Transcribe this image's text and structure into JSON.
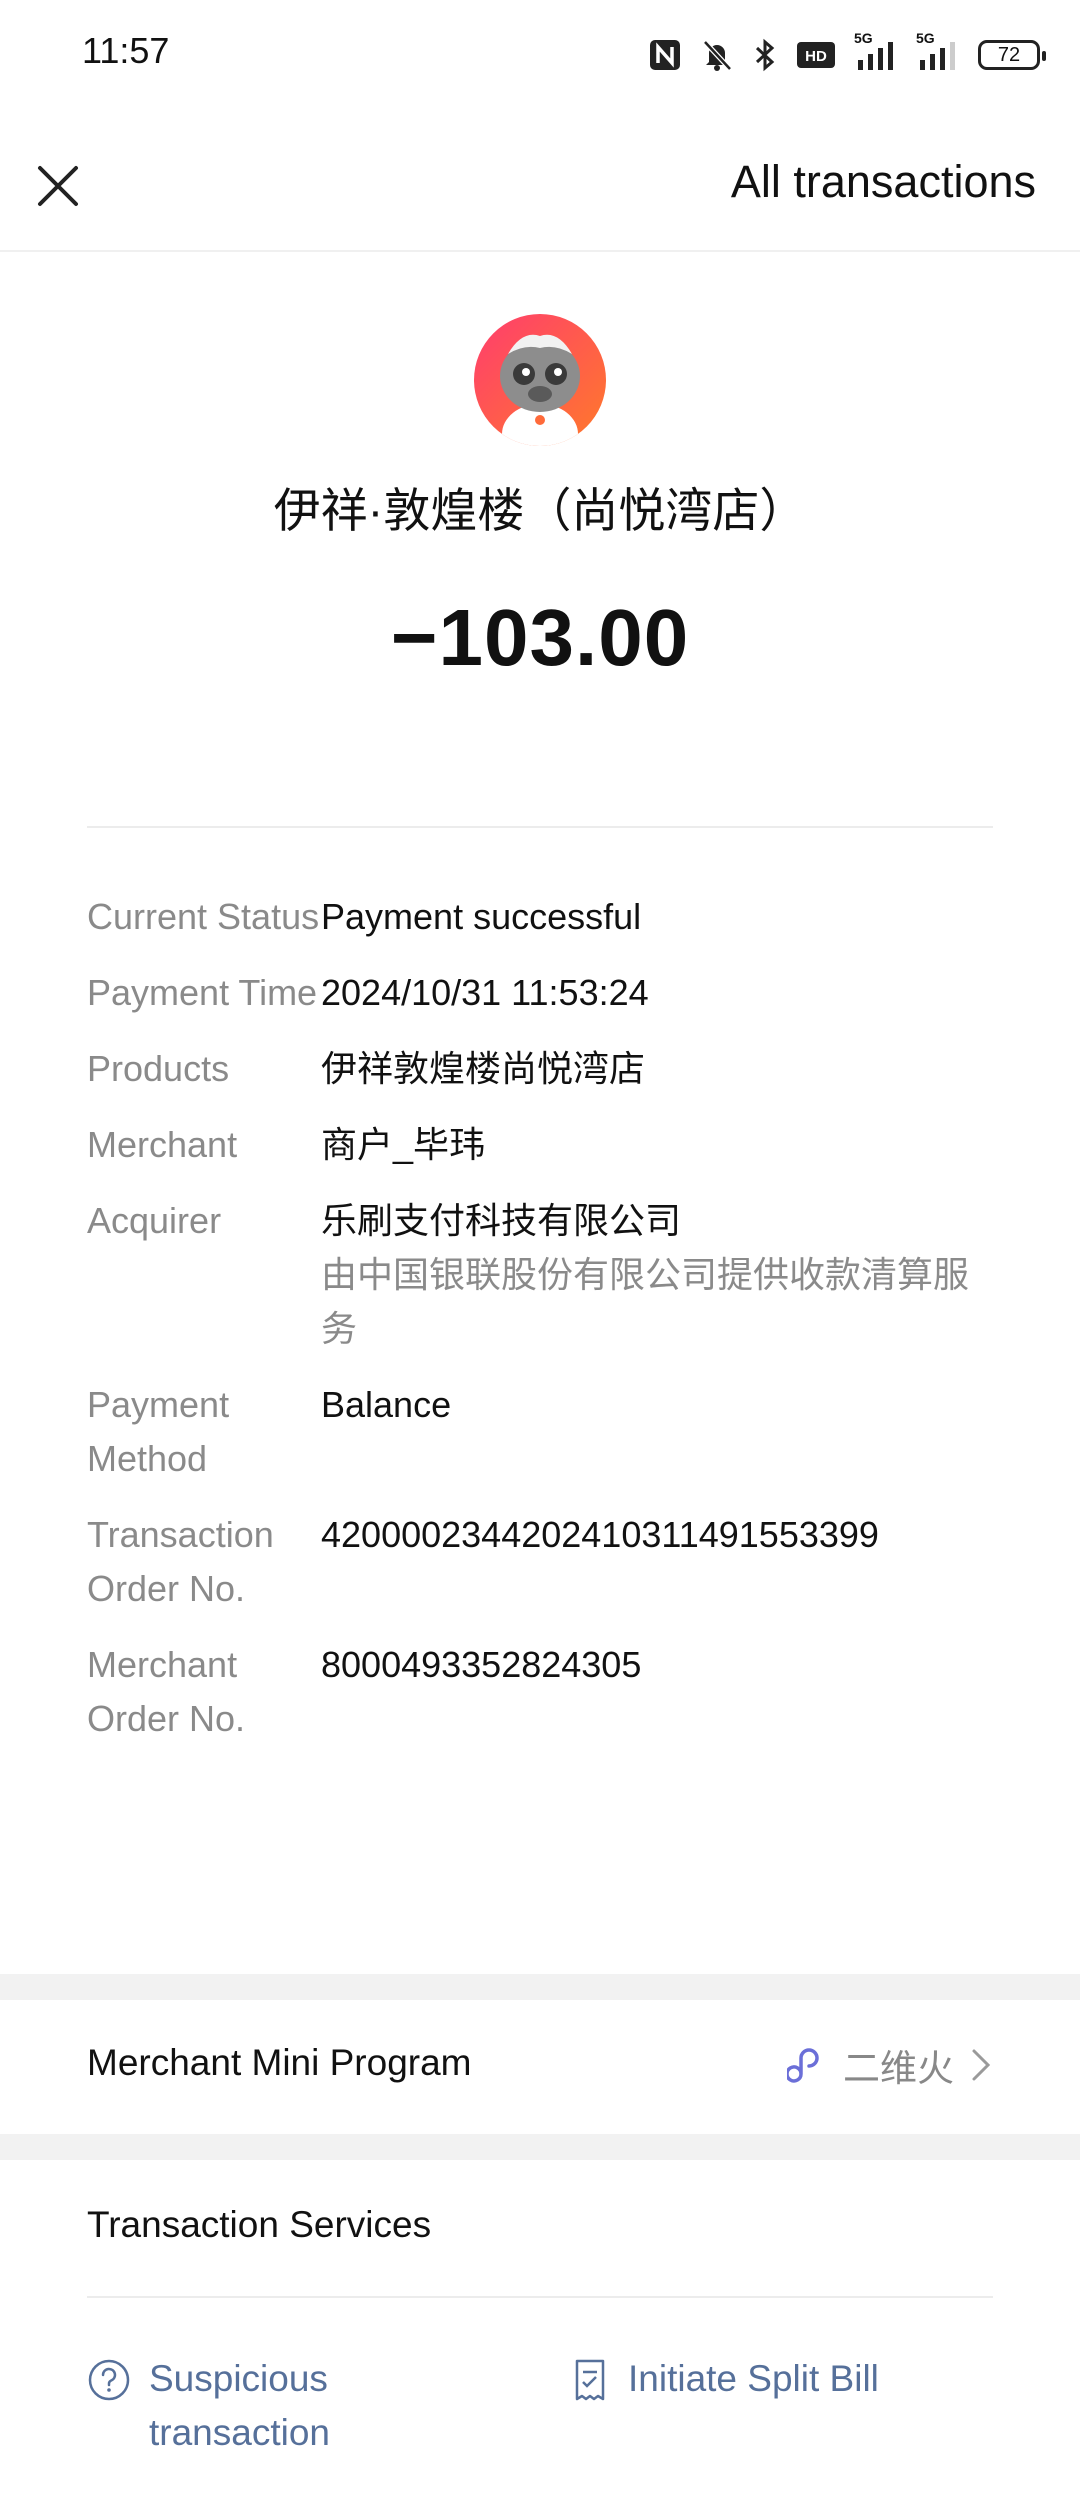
{
  "status_bar": {
    "time": "11:57",
    "battery": "72",
    "signal_1": "5G",
    "signal_2": "5G"
  },
  "header": {
    "close_icon": "close-icon",
    "all_transactions": "All transactions"
  },
  "merchant": {
    "name": "伊祥·敦煌楼（尚悦湾店）",
    "amount": "−103.00"
  },
  "details": [
    {
      "label": "Current Status",
      "value": "Payment successful"
    },
    {
      "label": "Payment Time",
      "value": "2024/10/31 11:53:24"
    },
    {
      "label": "Products",
      "value": "伊祥敦煌楼尚悦湾店"
    },
    {
      "label": "Merchant",
      "value": "商户_毕玮"
    },
    {
      "label": "Acquirer",
      "value": "乐刷支付科技有限公司",
      "sub": "由中国银联股份有限公司提供收款清算服务"
    },
    {
      "label": "Payment Method",
      "value": "Balance"
    },
    {
      "label": "Transaction Order No.",
      "value": "4200002344202410311491553399"
    },
    {
      "label": "Merchant Order No.",
      "value": "8000493352824305"
    }
  ],
  "mini_program": {
    "label": "Merchant Mini Program",
    "name": "二维火"
  },
  "services": {
    "title": "Transaction Services",
    "suspicious": "Suspicious transaction",
    "split_bill": "Initiate Split Bill"
  },
  "colors": {
    "link": "#56709a",
    "mini_icon": "#6b6fd8"
  }
}
